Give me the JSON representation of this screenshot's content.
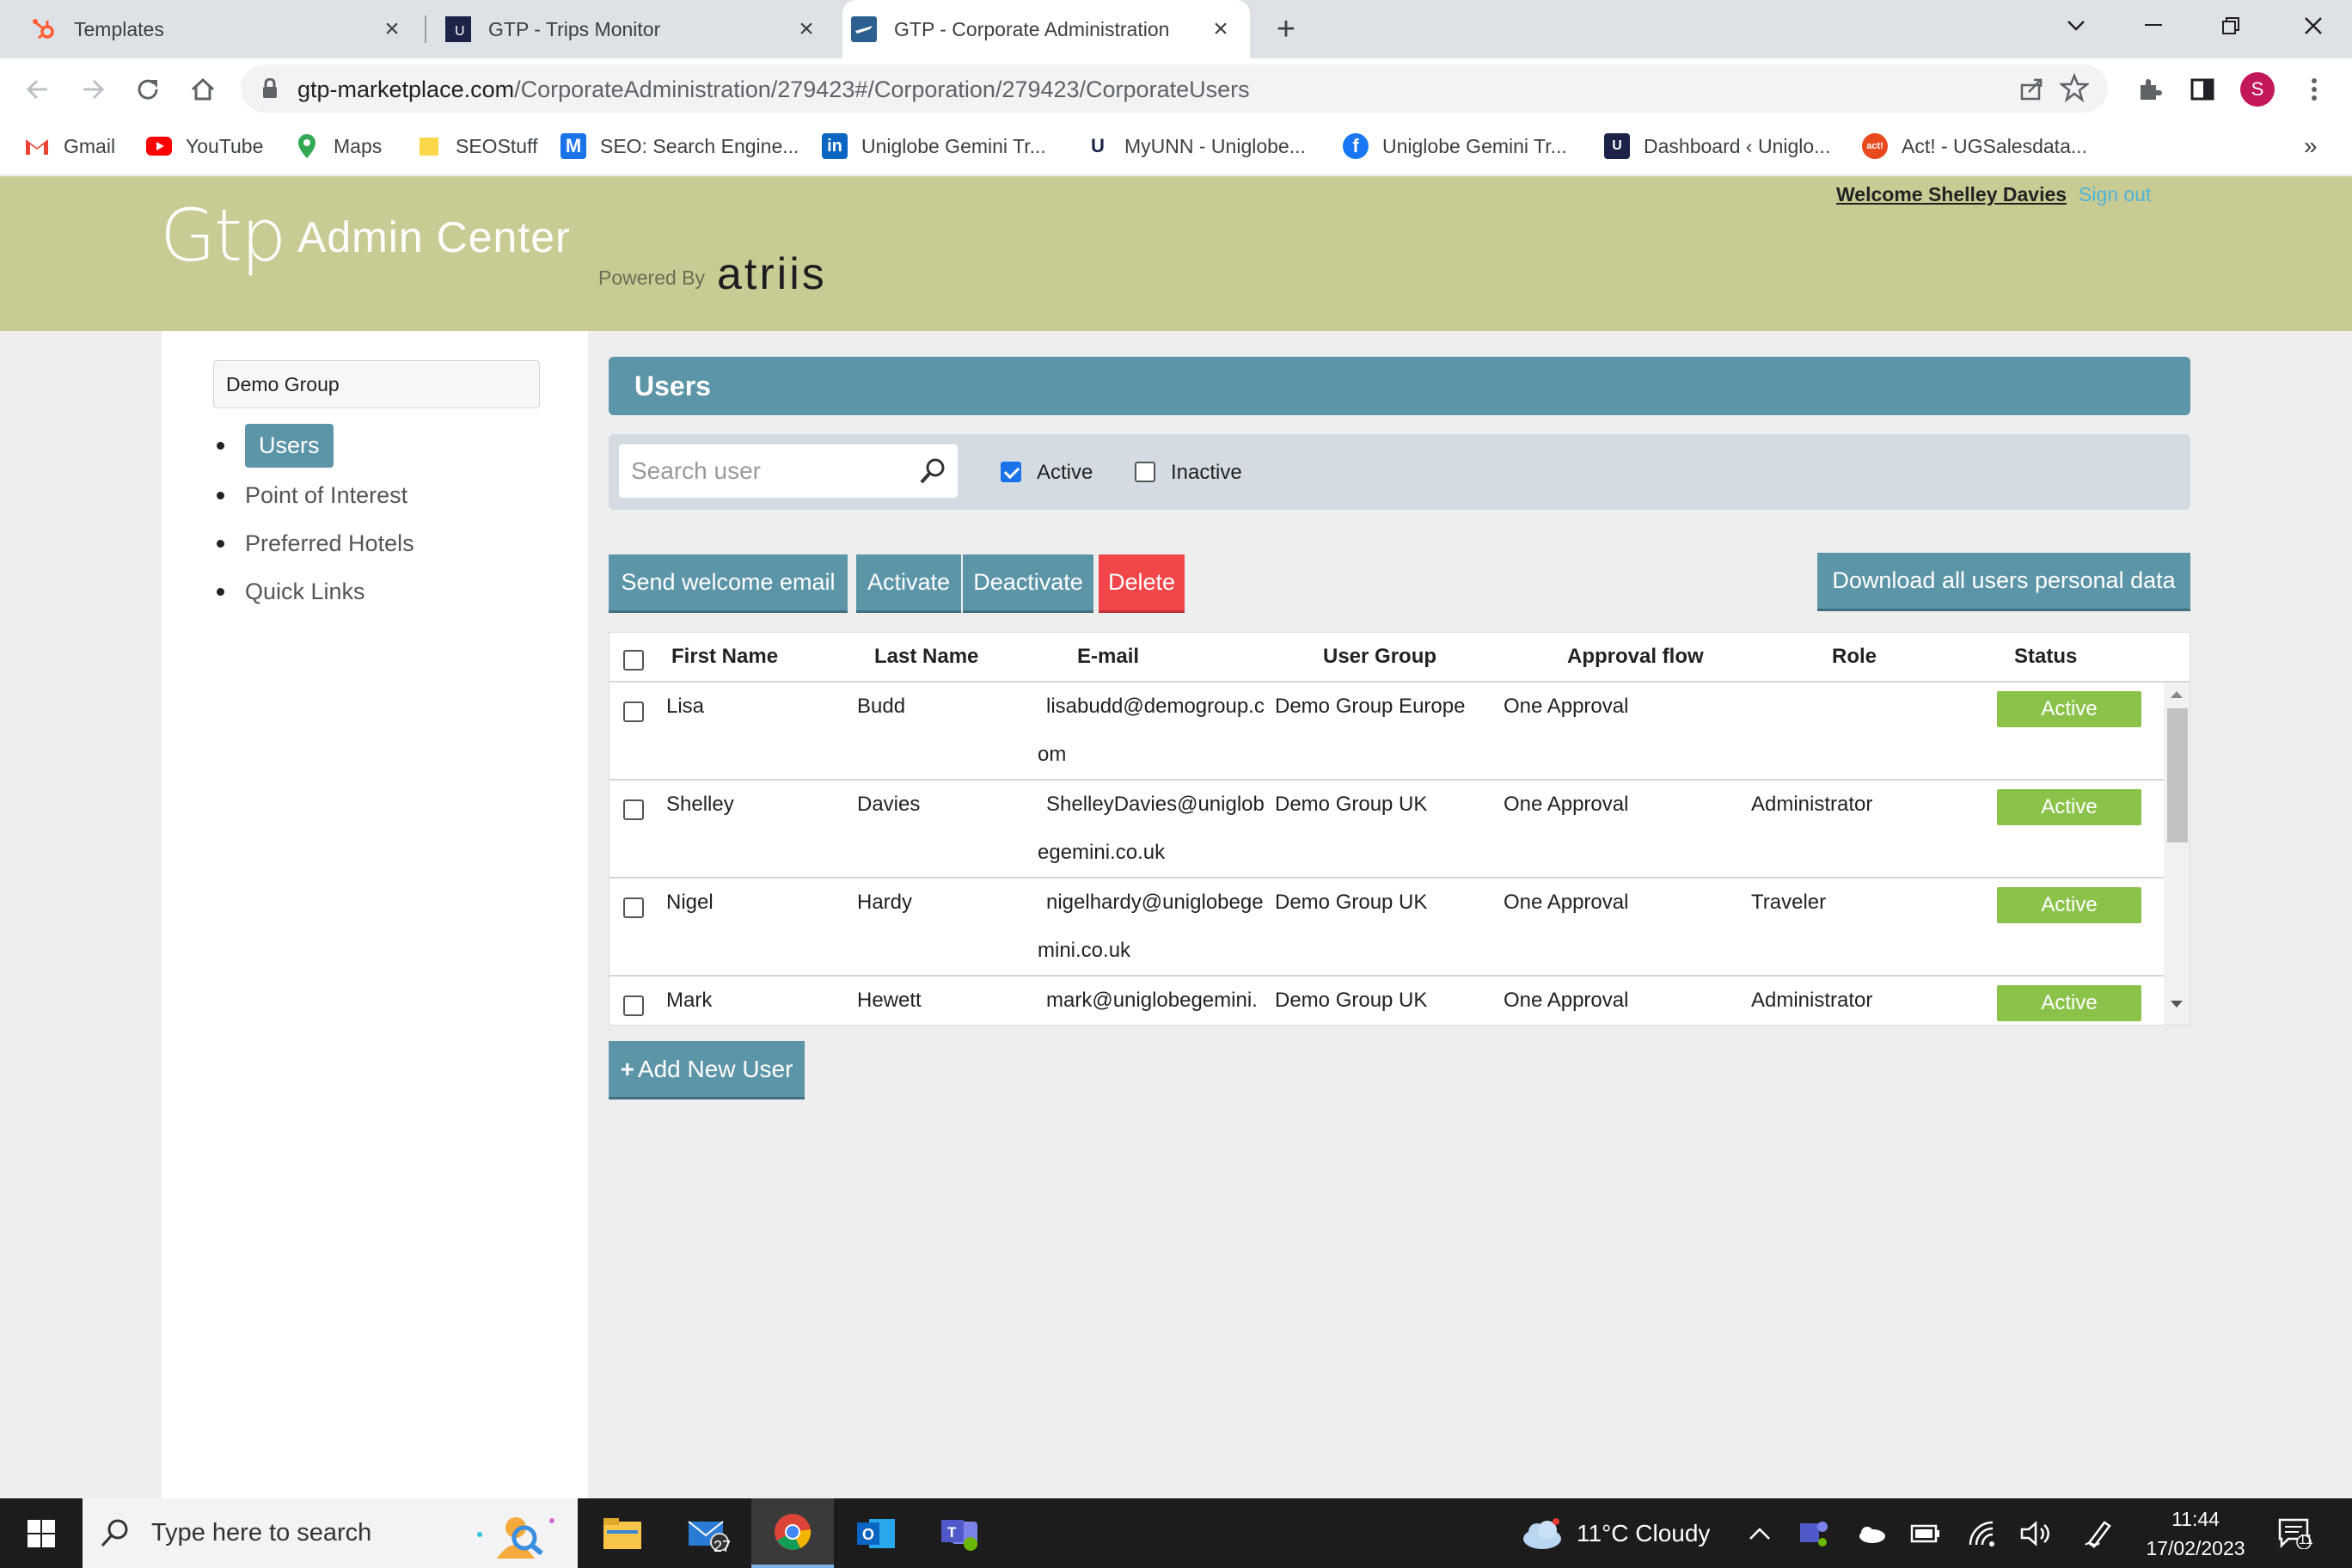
{
  "browser": {
    "tabs": [
      {
        "title": "Templates",
        "active": false
      },
      {
        "title": "GTP - Trips Monitor",
        "active": false
      },
      {
        "title": "GTP - Corporate Administration",
        "active": true
      }
    ],
    "url_host": "gtp-marketplace.com",
    "url_path": "/CorporateAdministration/279423#/Corporation/279423/CorporateUsers",
    "profile_initial": "S",
    "bookmarks": [
      {
        "label": "Gmail",
        "icon": "gmail-icon"
      },
      {
        "label": "YouTube",
        "icon": "youtube-icon"
      },
      {
        "label": "Maps",
        "icon": "maps-icon"
      },
      {
        "label": "SEOStuff",
        "icon": "folder-icon"
      },
      {
        "label": "SEO: Search Engine...",
        "icon": "seo-icon"
      },
      {
        "label": "Uniglobe Gemini Tr...",
        "icon": "linkedin-icon"
      },
      {
        "label": "MyUNN - Uniglobe...",
        "icon": "uniglobe-icon"
      },
      {
        "label": "Uniglobe Gemini Tr...",
        "icon": "facebook-icon"
      },
      {
        "label": "Dashboard ‹ Uniglo...",
        "icon": "uniglobe-icon"
      },
      {
        "label": "Act! - UGSalesdata...",
        "icon": "act-icon"
      }
    ],
    "more_bookmarks": "»"
  },
  "header": {
    "logo_gtp": "Gtp",
    "logo_admin": "Admin Center",
    "powered_by": "Powered By",
    "atriis": "atriis",
    "welcome": "Welcome Shelley Davies",
    "signout": "Sign out"
  },
  "sidebar": {
    "group": "Demo Group",
    "items": [
      {
        "label": "Users",
        "selected": true
      },
      {
        "label": "Point of Interest",
        "selected": false
      },
      {
        "label": "Preferred Hotels",
        "selected": false
      },
      {
        "label": "Quick Links",
        "selected": false
      }
    ]
  },
  "main": {
    "title": "Users",
    "search_placeholder": "Search user",
    "filter_active": "Active",
    "filter_inactive": "Inactive",
    "active_checked": true,
    "inactive_checked": false,
    "buttons": {
      "welcome": "Send welcome email",
      "activate": "Activate",
      "deactivate": "Deactivate",
      "delete": "Delete",
      "download": "Download all users personal data"
    },
    "columns": [
      "First Name",
      "Last Name",
      "E-mail",
      "User Group",
      "Approval flow",
      "Role",
      "Status"
    ],
    "rows": [
      {
        "first": "Lisa",
        "last": "Budd",
        "email": "lisabudd@demogroup.com",
        "group": "Demo Group Europe",
        "approval": "One Approval",
        "role": "",
        "status": "Active"
      },
      {
        "first": "Shelley",
        "last": "Davies",
        "email": "ShelleyDavies@uniglobegemini.co.uk",
        "group": "Demo Group UK",
        "approval": "One Approval",
        "role": "Administrator",
        "status": "Active"
      },
      {
        "first": "Nigel",
        "last": "Hardy",
        "email": "nigelhardy@uniglobegemini.co.uk",
        "group": "Demo Group UK",
        "approval": "One Approval",
        "role": "Traveler",
        "status": "Active"
      },
      {
        "first": "Mark",
        "last": "Hewett",
        "email": "mark@uniglobegemini.",
        "group": "Demo Group UK",
        "approval": "One Approval",
        "role": "Administrator",
        "status": "Active"
      }
    ],
    "add_user": "Add New User"
  },
  "taskbar": {
    "search_placeholder": "Type here to search",
    "mail_badge": "27",
    "weather": "11°C  Cloudy",
    "time": "11:44",
    "date": "17/02/2023",
    "notifications": "11"
  },
  "colors": {
    "header_bg": "#c9cb94",
    "accent": "#5d95a8",
    "danger": "#f2464a",
    "status_active": "#8bc34a"
  }
}
